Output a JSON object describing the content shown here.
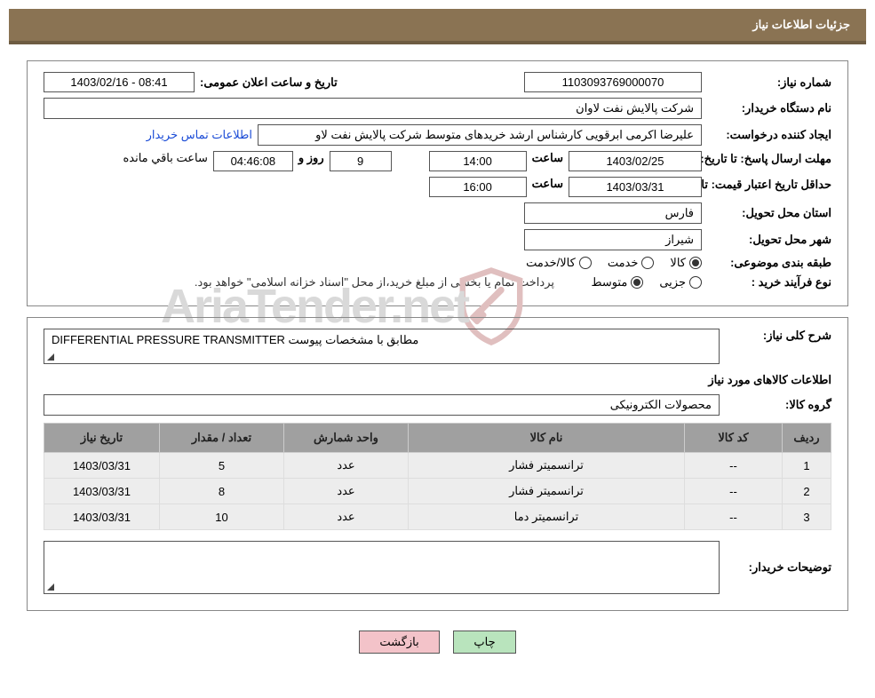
{
  "header": {
    "title": "جزئیات اطلاعات نیاز"
  },
  "watermark": {
    "text": "AriaTender.net"
  },
  "info": {
    "need_no_label": "شماره نیاز:",
    "need_no": "1103093769000070",
    "announce_label": "تاریخ و ساعت اعلان عمومی:",
    "announce": "1403/02/16 - 08:41",
    "buyer_label": "نام دستگاه خریدار:",
    "buyer": "شرکت پالایش نفت لاوان",
    "requester_label": "ایجاد کننده درخواست:",
    "requester": "علیرضا اکرمی ابرقویی کارشناس ارشد خریدهای متوسط شرکت پالایش نفت لاو",
    "contact_link": "اطلاعات تماس خریدار",
    "deadline_line1": "مهلت ارسال پاسخ:",
    "until_date_label": "تا تاریخ:",
    "deadline_date": "1403/02/25",
    "time_label": "ساعت",
    "deadline_time": "14:00",
    "days": "9",
    "days_and_label": "روز و",
    "countdown": "04:46:08",
    "remaining_label": "ساعت باقي مانده",
    "validity_line1": "حداقل تاریخ اعتبار قیمت:",
    "validity_date": "1403/03/31",
    "validity_time": "16:00",
    "province_label": "استان محل تحویل:",
    "province": "فارس",
    "city_label": "شهر محل تحویل:",
    "city": "شیراز",
    "classify_label": "طبقه بندی موضوعی:",
    "classify_opts": {
      "goods": "کالا",
      "service": "خدمت",
      "goods_service": "کالا/خدمت"
    },
    "process_label": "نوع فرآیند خرید :",
    "process_opts": {
      "partial": "جزیی",
      "medium": "متوسط"
    },
    "process_note": "پرداخت تمام یا بخشی از مبلغ خرید،از محل \"اسناد خزانه اسلامی\" خواهد بود."
  },
  "details": {
    "overall_label": "شرح کلی نیاز:",
    "overall": "DIFFERENTIAL PRESSURE TRANSMITTER مطابق با مشخصات پیوست",
    "goods_info_title": "اطلاعات کالاهای مورد نیاز",
    "group_label": "گروه کالا:",
    "group": "محصولات الکترونیکی",
    "columns": {
      "row": "ردیف",
      "code": "کد کالا",
      "name": "نام کالا",
      "unit": "واحد شمارش",
      "qty": "تعداد / مقدار",
      "date": "تاریخ نیاز"
    },
    "rows": [
      {
        "row": "1",
        "code": "--",
        "name": "ترانسمیتر فشار",
        "unit": "عدد",
        "qty": "5",
        "date": "1403/03/31"
      },
      {
        "row": "2",
        "code": "--",
        "name": "ترانسمیتر فشار",
        "unit": "عدد",
        "qty": "8",
        "date": "1403/03/31"
      },
      {
        "row": "3",
        "code": "--",
        "name": "ترانسمیتر دما",
        "unit": "عدد",
        "qty": "10",
        "date": "1403/03/31"
      }
    ],
    "buyer_notes_label": "توضیحات خریدار:"
  },
  "buttons": {
    "print": "چاپ",
    "back": "بازگشت"
  }
}
